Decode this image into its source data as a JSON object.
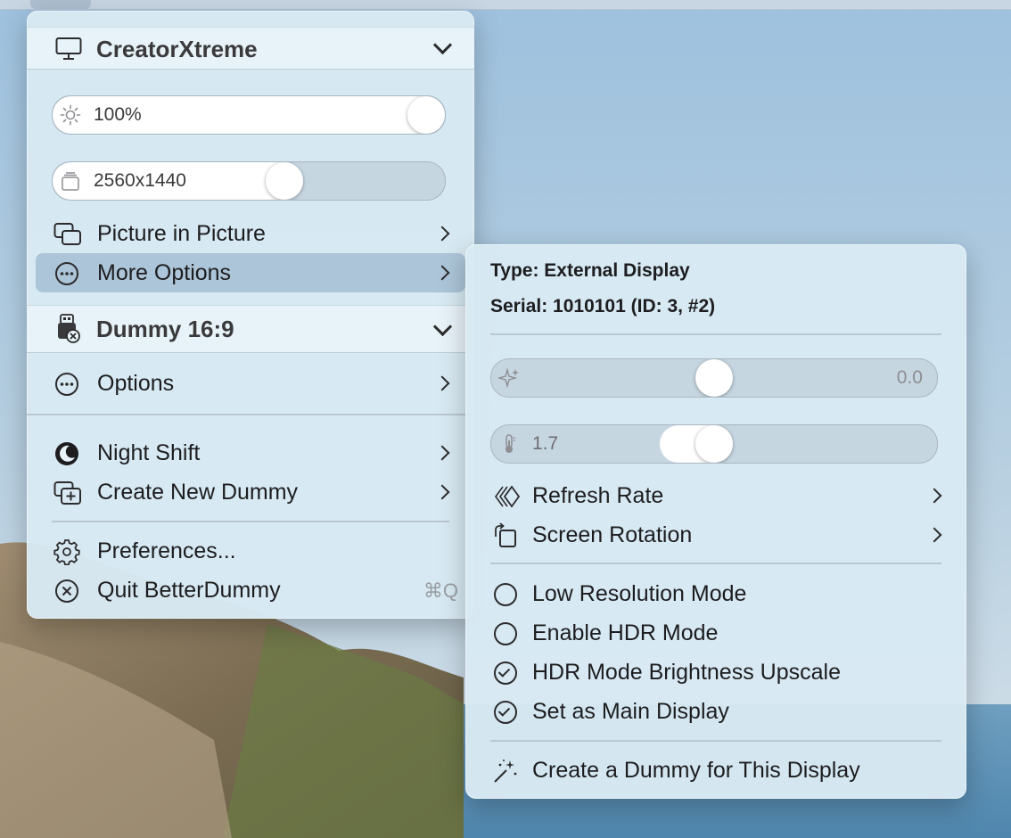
{
  "main_menu": {
    "display": {
      "name": "CreatorXtreme",
      "brightness": {
        "value_text": "100%",
        "level": 1.0
      },
      "resolution": {
        "value_text": "2560x1440",
        "level": 0.6
      },
      "items": [
        {
          "label": "Picture in Picture"
        },
        {
          "label": "More Options"
        }
      ]
    },
    "dummy": {
      "name": "Dummy 16:9",
      "items": [
        {
          "label": "Options"
        }
      ]
    },
    "general_items": [
      {
        "label": "Night Shift"
      },
      {
        "label": "Create New Dummy"
      }
    ],
    "footer_items": [
      {
        "label": "Preferences..."
      },
      {
        "label": "Quit BetterDummy",
        "shortcut": "⌘Q"
      }
    ]
  },
  "sub_menu": {
    "type_line": "Type: External Display",
    "serial_line": "Serial: 1010101 (ID: 3, #2)",
    "sharpness": {
      "value_text": "0.0",
      "level": 0.5
    },
    "gamma": {
      "value_text": "1.7",
      "level": 0.5
    },
    "nav_items": [
      {
        "label": "Refresh Rate"
      },
      {
        "label": "Screen Rotation"
      }
    ],
    "options": [
      {
        "label": "Low Resolution Mode",
        "checked": false
      },
      {
        "label": "Enable HDR Mode",
        "checked": false
      },
      {
        "label": "HDR Mode Brightness Upscale",
        "checked": true
      },
      {
        "label": "Set as Main Display",
        "checked": true
      }
    ],
    "action": {
      "label": "Create a Dummy for This Display"
    }
  }
}
